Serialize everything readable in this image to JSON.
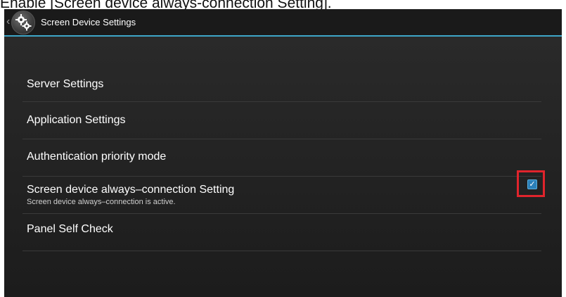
{
  "caption": "Enable [Screen device always-connection Setting].",
  "titlebar": {
    "title": "Screen Device Settings",
    "back_icon": "chevron-left-icon",
    "app_icon": "gear-icon"
  },
  "settings": {
    "items": [
      {
        "label": "Server Settings"
      },
      {
        "label": "Application Settings"
      },
      {
        "label": "Authentication priority mode"
      },
      {
        "label": "Screen device always–connection Setting",
        "sublabel": "Screen device always–connection is active.",
        "checked": true
      },
      {
        "label": "Panel Self Check"
      }
    ]
  },
  "colors": {
    "accent": "#3ea6c8",
    "highlight": "#e0242c",
    "checkbox": "#2b7fb8"
  }
}
